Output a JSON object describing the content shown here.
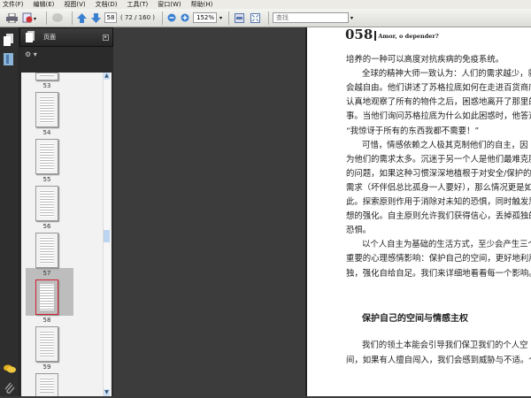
{
  "menu": [
    "文件(F)",
    "编辑(E)",
    "视图(V)",
    "文档(D)",
    "工具(T)",
    "窗口(W)",
    "帮助(H)"
  ],
  "toolbar": {
    "page_input": "58",
    "page_count": "( 72 / 160 )",
    "zoom": "152%",
    "search_placeholder": "查找"
  },
  "panel": {
    "title": "页面",
    "thumbnails": [
      "53",
      "54",
      "55",
      "56",
      "57",
      "58",
      "59"
    ],
    "selected": "58"
  },
  "document": {
    "page_number": "058",
    "running_title": "Amor, o depender?",
    "lines": [
      "培养的一种可以高度对抗疾病的免疫系统。",
      "全球的精神大师一致认为：人们的需求越少，就",
      "会越自由。他们讲述了苏格拉底如何在走进百货商店，",
      "认真地观察了所有的物件之后，困惑地离开了那里的故",
      "事。当他们询问苏格拉底为什么如此困惑时，他答道：",
      "“我惊讶于所有的东西我都不需要！”",
      "可惜，情感依赖之人极其克制他们的自主，因",
      "为他们的需求太多。沉迷于另一个人是他们最难克服",
      "的问题，如果这种习惯深深地植根于对安全/保护的",
      "需求（坏伴侣总比孤身一人要好），那么情况更是如",
      "此。探索原则作用于消除对未知的恐惧，同时触发思",
      "想的强化。自主原则允许我们获得信心，丢掉孤独的",
      "恐惧。",
      "以个人自主为基础的生活方式，至少会产生三个",
      "重要的心理感情影响：保护自己的空间，更好地利用孤",
      "独，强化自给自足。我们来详细地看看每一个影响。"
    ],
    "heading": "保护自己的空间与情感主权",
    "lines2": [
      "我们的领土本能会引导我们保卫我们的个人空",
      "间，如果有人擅自闯入，我们会感到威胁与不适。个体"
    ]
  }
}
